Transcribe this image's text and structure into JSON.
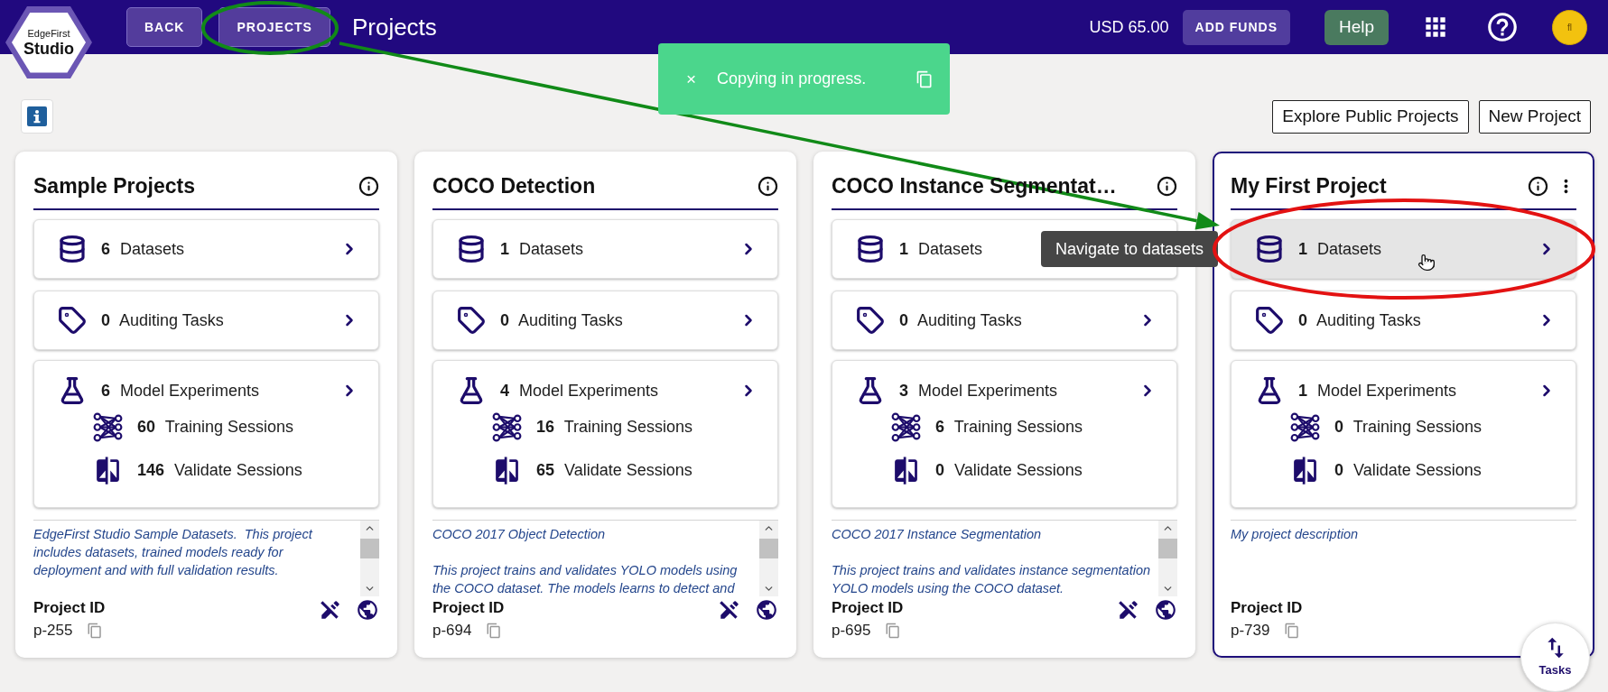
{
  "header": {
    "logo": {
      "line_1": "EdgeFirst",
      "line_2": "Studio"
    },
    "nav_buttons": [
      "BACK",
      "PROJECTS"
    ],
    "title": "Projects",
    "balance": "USD 65.00",
    "add_funds": "ADD FUNDS",
    "help": "Help",
    "avatar": "fl"
  },
  "toast": {
    "close": "×",
    "message": "Copying in progress."
  },
  "toolbar": {
    "buttons": [
      "Explore Public Projects",
      "New Project"
    ]
  },
  "projects": [
    {
      "title": "Sample Projects",
      "selected": false,
      "menu": false,
      "links": [
        {
          "kind": "datasets",
          "text": "**6** Datasets",
          "hovered": false
        },
        {
          "kind": "tasks",
          "text": "**0** Auditing Tasks",
          "hovered": false
        }
      ],
      "experiments": {
        "text": "**6** Model Experiments",
        "sessions": [
          {
            "kind": "training",
            "text": "**60** Training Sessions"
          },
          {
            "kind": "validate",
            "text": "**146** Validate Sessions"
          }
        ]
      },
      "description": {
        "paragraphs": [
          "EdgeFirst Studio Sample Datasets.  This project includes datasets, trained models ready for deployment and with full validation results."
        ],
        "scrollable": true
      },
      "id_label": "Project ID",
      "id": "p-255",
      "read_only": true,
      "public": true
    },
    {
      "title": "COCO Detection",
      "selected": false,
      "menu": false,
      "links": [
        {
          "kind": "datasets",
          "text": "**1** Datasets",
          "hovered": false
        },
        {
          "kind": "tasks",
          "text": "**0** Auditing Tasks",
          "hovered": false
        }
      ],
      "experiments": {
        "text": "**4** Model Experiments",
        "sessions": [
          {
            "kind": "training",
            "text": "**16** Training Sessions"
          },
          {
            "kind": "validate",
            "text": "**65** Validate Sessions"
          }
        ]
      },
      "description": {
        "paragraphs": [
          "COCO 2017 Object Detection",
          "This project trains and validates YOLO models using the COCO dataset. The models learns to detect and"
        ],
        "scrollable": true
      },
      "id_label": "Project ID",
      "id": "p-694",
      "read_only": true,
      "public": true
    },
    {
      "title": "COCO Instance Segmentat…",
      "selected": false,
      "menu": false,
      "links": [
        {
          "kind": "datasets",
          "text": "**1** Datasets",
          "hovered": false
        },
        {
          "kind": "tasks",
          "text": "**0** Auditing Tasks",
          "hovered": false
        }
      ],
      "experiments": {
        "text": "**3** Model Experiments",
        "sessions": [
          {
            "kind": "training",
            "text": "**6** Training Sessions"
          },
          {
            "kind": "validate",
            "text": "**0** Validate Sessions"
          }
        ]
      },
      "description": {
        "paragraphs": [
          "COCO 2017 Instance Segmentation",
          "This project trains and validates instance segmentation YOLO models using the COCO dataset."
        ],
        "scrollable": true
      },
      "id_label": "Project ID",
      "id": "p-695",
      "read_only": true,
      "public": true
    },
    {
      "title": "My First Project",
      "selected": true,
      "menu": true,
      "links": [
        {
          "kind": "datasets",
          "text": "**1** Datasets",
          "hovered": true,
          "tooltip": "Navigate to datasets"
        },
        {
          "kind": "tasks",
          "text": "**0** Auditing Tasks",
          "hovered": false
        }
      ],
      "experiments": {
        "text": "**1** Model Experiments",
        "sessions": [
          {
            "kind": "training",
            "text": "**0** Training Sessions"
          },
          {
            "kind": "validate",
            "text": "**0** Validate Sessions"
          }
        ]
      },
      "description": {
        "paragraphs": [
          "My project description"
        ],
        "scrollable": false
      },
      "id_label": "Project ID",
      "id": "p-739",
      "read_only": false,
      "public": false
    }
  ],
  "tasks_button": {
    "label": "Tasks"
  },
  "annotations": [
    {
      "kind": "ellipse",
      "color": "#118a18"
    },
    {
      "kind": "arrow",
      "color": "#118a18"
    },
    {
      "kind": "ellipse",
      "color": "#e31212"
    }
  ]
}
